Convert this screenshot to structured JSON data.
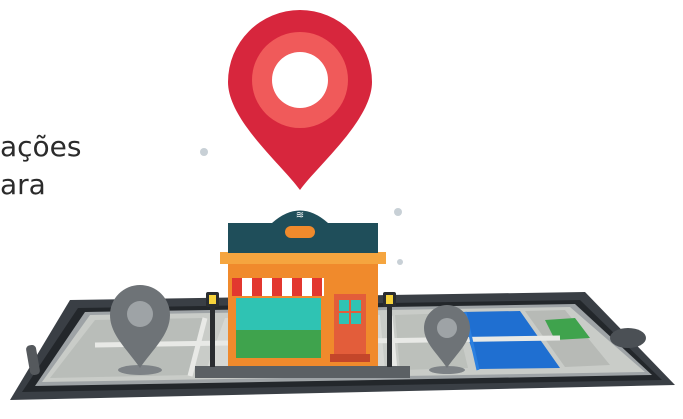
{
  "caption": {
    "line1": "ações",
    "line2": "ara"
  },
  "colors": {
    "pin_red": "#d7263d",
    "phone_body": "#3a3f45",
    "map_road": "#c9ccc8",
    "water": "#1f6fd1",
    "park": "#3fa34d",
    "shop_wall": "#f08a2c",
    "awning_red": "#e2372f",
    "roof_teal": "#1f4e5a"
  },
  "icons": [
    "location-pin-icon",
    "storefront-icon",
    "map-marker-icon",
    "smartphone-icon",
    "street-lamp-icon"
  ]
}
